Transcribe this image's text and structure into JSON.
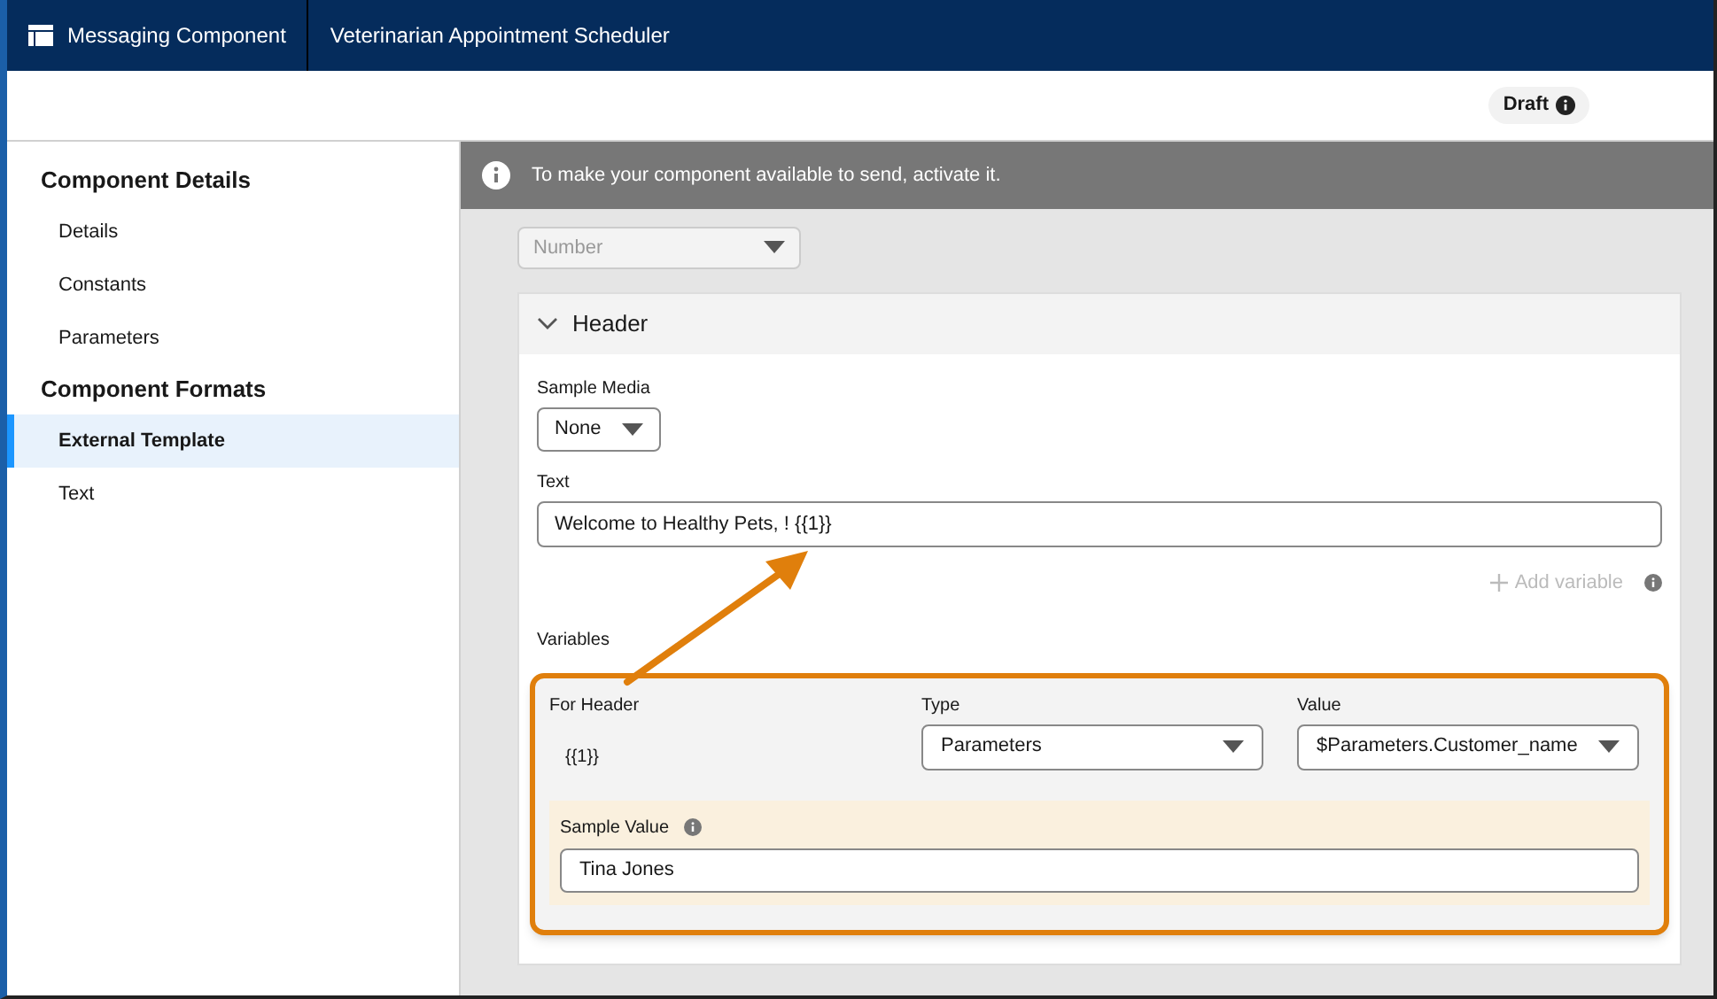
{
  "topbar": {
    "app": "Messaging Component",
    "record": "Veterinarian Appointment Scheduler"
  },
  "status_badge": "Draft",
  "sidebar": {
    "sections": [
      {
        "heading": "Component Details",
        "items": [
          {
            "label": "Details",
            "selected": false
          },
          {
            "label": "Constants",
            "selected": false
          },
          {
            "label": "Parameters",
            "selected": false
          }
        ]
      },
      {
        "heading": "Component Formats",
        "items": [
          {
            "label": "External Template",
            "selected": true
          },
          {
            "label": "Text",
            "selected": false
          }
        ]
      }
    ]
  },
  "banner": "To make your component available to send, activate it.",
  "number_select": {
    "value": "Number",
    "disabled": true
  },
  "header_section": {
    "title": "Header",
    "expanded": true,
    "sample_media": {
      "label": "Sample Media",
      "value": "None"
    },
    "text": {
      "label": "Text",
      "value": "Welcome to Healthy Pets, ! {{1}}"
    },
    "add_variable": "Add variable",
    "variables_label": "Variables",
    "variable": {
      "for_label": "For Header",
      "token": "{{1}}",
      "type_label": "Type",
      "type_value": "Parameters",
      "value_label": "Value",
      "value_value": "$Parameters.Customer_name",
      "sample_label": "Sample Value",
      "sample_value": "Tina Jones"
    }
  }
}
